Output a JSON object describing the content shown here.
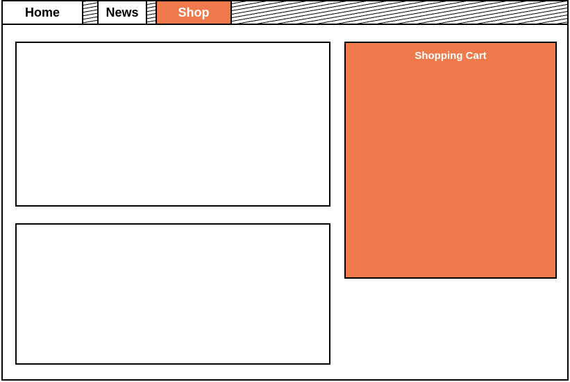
{
  "nav": {
    "tabs": [
      {
        "label": "Home",
        "active": false
      },
      {
        "label": "News",
        "active": false
      },
      {
        "label": "Shop",
        "active": true
      }
    ]
  },
  "cart": {
    "title": "Shopping Cart"
  },
  "colors": {
    "accent": "#ee7a4b"
  }
}
